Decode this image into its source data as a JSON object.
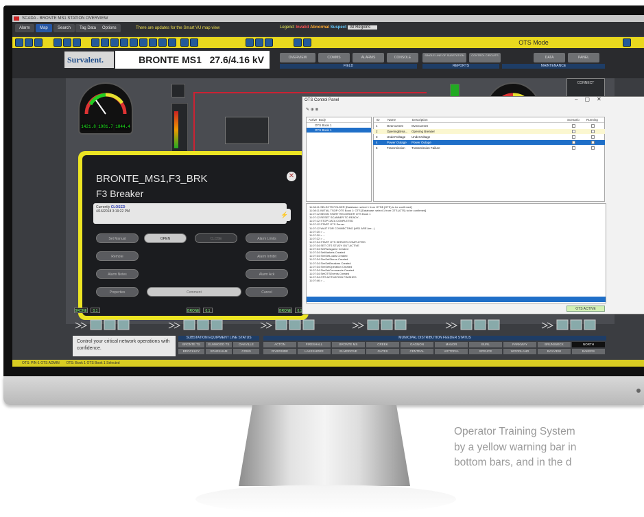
{
  "window": {
    "title": "SCADA - BRONTE MS1 STATION OVERVIEW"
  },
  "menubar": {
    "menus": [
      "Alarm",
      "Map",
      "Search",
      "Tag Data",
      "Options"
    ],
    "message": "There are updates for the Smart VU map view",
    "legend_label": "Legend:",
    "legend_items": [
      "Invalid",
      "Abnormal",
      "Suspect"
    ],
    "region_select": "All Regions"
  },
  "toolbar": {
    "mode": "OTS Mode"
  },
  "banner": {
    "logo": "Survalent.",
    "station": "BRONTE MS1",
    "voltage": "27.6/4.16 kV",
    "tabs": [
      "OVERVIEW",
      "COMMS",
      "ALARMS",
      "CONSOLE",
      "SINGLE LINE OF SUBSTATION",
      "CONTROL CIRCUITS",
      "DATA",
      "PANEL"
    ],
    "groups": [
      "FIELD",
      "REPORTS",
      "MAINTENANCE"
    ]
  },
  "gauges": {
    "left_readouts": [
      "1421.8",
      "1981.7",
      "1844.4"
    ],
    "right_title": "CONNECT"
  },
  "breaker_dialog": {
    "title": "BRONTE_MS1,F3_BRK",
    "subtitle": "F3 Breaker",
    "status_prefix": "Currently",
    "status_value": "CLOSED",
    "status_time": "4/16/2018 3:19:22 PM",
    "buttons": [
      "Set Manual",
      "OPEN",
      "CLOSE",
      "Alarm Limits",
      "Remote",
      "Alarm Inhibit",
      "Alarm Notes",
      "Alarm Ack",
      "Properties",
      "Comment",
      "Cancel"
    ]
  },
  "ots_panel": {
    "title": "OTS Control Panel",
    "tree_headers": [
      "Active",
      "Body"
    ],
    "tree_items": [
      "OTS Book 1",
      "OTS Book 1"
    ],
    "table_headers": [
      "ID",
      "Name",
      "Description",
      "Scenario",
      "Running"
    ],
    "table_rows": [
      {
        "id": "1",
        "name": "Overcurrent",
        "desc": "Overcurrent"
      },
      {
        "id": "2",
        "name": "OpeningBrea...",
        "desc": "Opening Breaker"
      },
      {
        "id": "3",
        "name": "UnderVoltage",
        "desc": "UnderVoltage"
      },
      {
        "id": "4",
        "name": "Power Outage",
        "desc": "Power Outage"
      },
      {
        "id": "5",
        "name": "Transmission",
        "desc": "Transmission Failure"
      }
    ],
    "log_lines": [
      "11:08:11 SELECTS FOLDER [Database: select 1 from OTS$ (OTS) to be confirmed]",
      "11:08:11 INITIAL TSOP OTS Book 1: OTS [Database: select 1 from OTS (OTS) to be confirmed]",
      "11:07:12 BEGIN START RECORDER OTS Book 1",
      "11:07:12 RESET SCANNER TO READY...",
      "11:07:12 STOP DATA COMPLETED",
      "11:07:12 START OTS Server",
      "11:07:12 WAIT FOR CONNECTING (MS1 ARE Are...)",
      "11:07:20 > ...",
      "11:07:20 > ...",
      "11:07:22 > ...",
      "11:07:34 START OTS SERVER COMPLETED",
      "11:07:34 SET OTS STUDY OUT ACTIVE",
      "11:07:34 SetRsdsgame Created",
      "11:07:34 SetMarkets Created",
      "11:07:34 SimSetLoads Created",
      "11:07:34 SimSetStores Created",
      "11:07:34 SimSetBreakers Created",
      "11:07:34 SimSetOperation Created",
      "11:07:34 SimSetCommands Created",
      "11:07:34 SetOTSEvents Created",
      "11:07:34 OTS ACTIVATION FINISHED",
      "11:07:46 > ..."
    ],
    "run_button": "OTS ACTIVE"
  },
  "bottom": {
    "meter_values": [
      "BRONE",
      "0.1",
      "BRONE",
      "0.1",
      "BRONE",
      "0.1"
    ],
    "tagline": "Control your critical network operations with confidence.",
    "grid_left_header": "SUBSTATION EQUIPMENT LINE STATUS",
    "grid_left": [
      "BRONTE TS",
      "ELMWOOD TS",
      "OAKVILLE",
      "BROCKLEY",
      "SPARKHAM",
      "CONN"
    ],
    "grid_right_header": "MUNICIPAL DISTRIBUTION FEEDER STATUS",
    "grid_right": [
      "ACTON",
      "FIRESHALL",
      "BRONTE MS",
      "CREEK",
      "GAGNON",
      "MANOR",
      "BURL",
      "PARKWAY",
      "BRUNSWICK",
      "NORTH",
      "RIVERSIDE",
      "LAKESHORE",
      "ELMGROVE",
      "GATES",
      "CENTRAL",
      "VICTORIA",
      "SPRUCE",
      "WOODLAND",
      "BAYVIEW",
      "BAKERS"
    ],
    "status_left": "OTS: PIN-1 OTS ADMIN",
    "status_mid": "OTS: Book 1 OTS Book 1 Selected"
  },
  "caption": {
    "lines": [
      "Operator Training System",
      "by a yellow warning bar in",
      "bottom bars, and in the d"
    ]
  },
  "colors": {
    "ots_yellow": "#e9d81e",
    "selection_blue": "#1f6fc8",
    "alarm_red": "#cc2233"
  }
}
